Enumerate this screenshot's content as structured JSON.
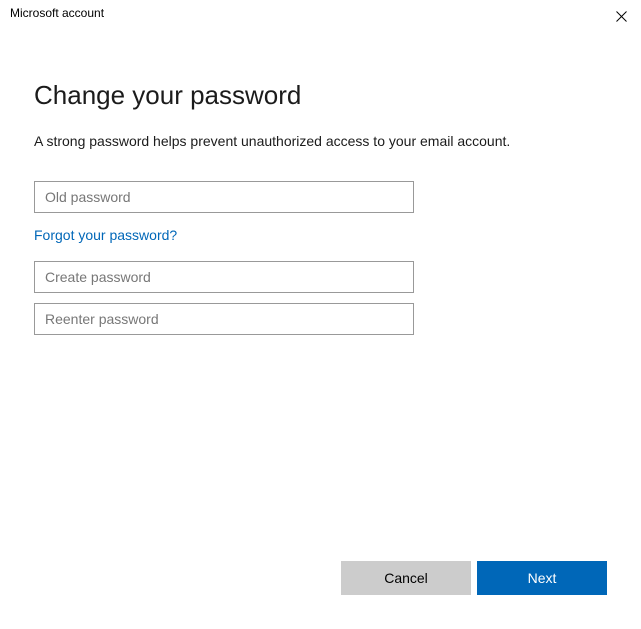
{
  "window": {
    "title": "Microsoft account"
  },
  "page": {
    "heading": "Change your password",
    "subtext": "A strong password helps prevent unauthorized access to your email account."
  },
  "fields": {
    "old_password": {
      "placeholder": "Old password",
      "value": ""
    },
    "create_password": {
      "placeholder": "Create password",
      "value": ""
    },
    "reenter_password": {
      "placeholder": "Reenter password",
      "value": ""
    }
  },
  "links": {
    "forgot": "Forgot your password?"
  },
  "buttons": {
    "cancel": "Cancel",
    "next": "Next"
  }
}
